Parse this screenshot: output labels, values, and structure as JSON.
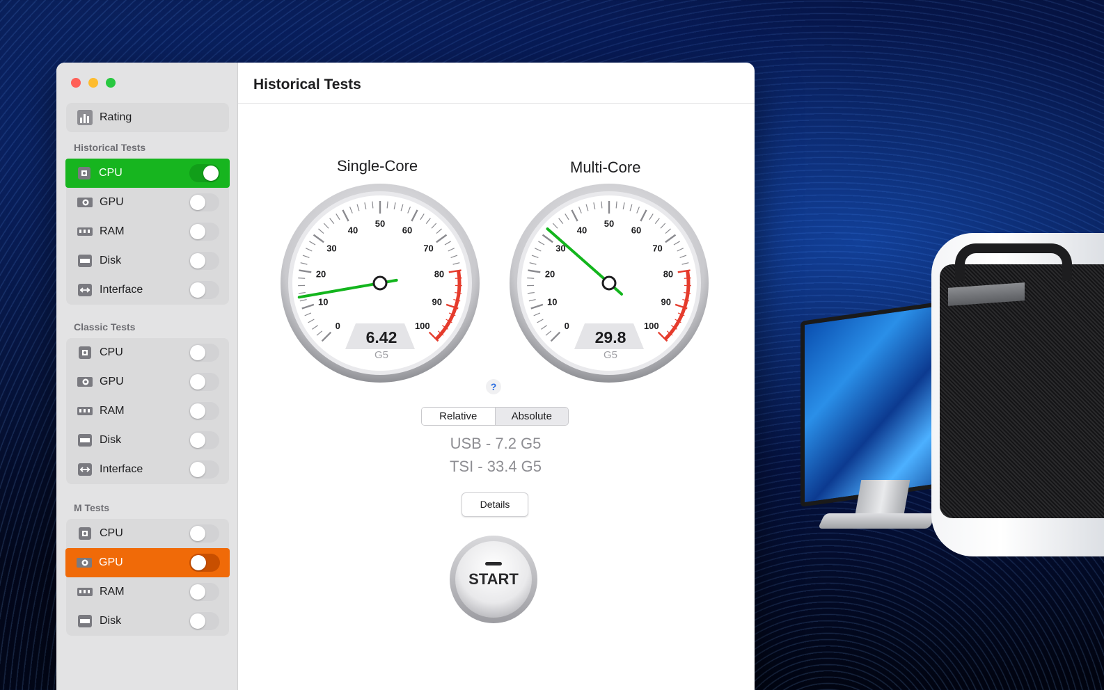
{
  "window": {
    "header_title": "Historical Tests"
  },
  "sidebar": {
    "top": {
      "label": "Rating",
      "icon": "bar-chart-icon"
    },
    "sections": [
      {
        "title": "Historical Tests",
        "items": [
          {
            "label": "CPU",
            "icon": "cpu-icon",
            "enabled": true,
            "selected": "green"
          },
          {
            "label": "GPU",
            "icon": "gpu-icon",
            "enabled": false
          },
          {
            "label": "RAM",
            "icon": "ram-icon",
            "enabled": false
          },
          {
            "label": "Disk",
            "icon": "disk-icon",
            "enabled": false
          },
          {
            "label": "Interface",
            "icon": "interface-icon",
            "enabled": false
          }
        ]
      },
      {
        "title": "Classic Tests",
        "items": [
          {
            "label": "CPU",
            "icon": "cpu-icon",
            "enabled": false
          },
          {
            "label": "GPU",
            "icon": "gpu-icon",
            "enabled": false
          },
          {
            "label": "RAM",
            "icon": "ram-icon",
            "enabled": false
          },
          {
            "label": "Disk",
            "icon": "disk-icon",
            "enabled": false
          },
          {
            "label": "Interface",
            "icon": "interface-icon",
            "enabled": false
          }
        ]
      },
      {
        "title": "M Tests",
        "items": [
          {
            "label": "CPU",
            "icon": "cpu-icon",
            "enabled": false
          },
          {
            "label": "GPU",
            "icon": "gpu-icon",
            "enabled": false,
            "selected": "orange"
          },
          {
            "label": "RAM",
            "icon": "ram-icon",
            "enabled": false
          },
          {
            "label": "Disk",
            "icon": "disk-icon",
            "enabled": false
          }
        ]
      }
    ]
  },
  "gauges": [
    {
      "title": "Single-Core",
      "value": "6.42",
      "unit": "G5",
      "needle_value": 13,
      "ticks": [
        "0",
        "10",
        "20",
        "30",
        "40",
        "50",
        "60",
        "70",
        "80",
        "90",
        "100"
      ]
    },
    {
      "title": "Multi-Core",
      "value": "29.8",
      "unit": "G5",
      "needle_value": 32,
      "ticks": [
        "0",
        "10",
        "20",
        "30",
        "40",
        "50",
        "60",
        "70",
        "80",
        "90",
        "100"
      ]
    }
  ],
  "help_label": "?",
  "mode": {
    "options": [
      "Relative",
      "Absolute"
    ],
    "selected": "Relative"
  },
  "results": {
    "line1": "USB - 7.2 G5",
    "line2": "TSI - 33.4 G5"
  },
  "details_label": "Details",
  "start_label": "START",
  "colors": {
    "selected_green": "#17b51f",
    "selected_orange": "#f06a08",
    "needle_green": "#13b51d",
    "redline": "#e53b2c"
  }
}
